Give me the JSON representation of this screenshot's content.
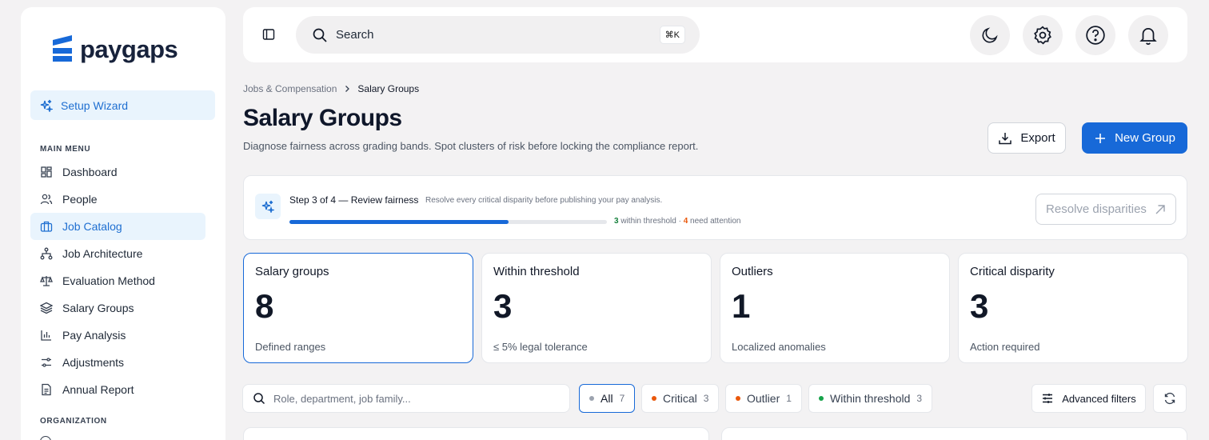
{
  "app": {
    "name": "paygaps"
  },
  "sidebar": {
    "wizard_label": "Setup Wizard",
    "main_menu_label": "MAIN MENU",
    "items": [
      {
        "label": "Dashboard",
        "icon": "dashboard-icon"
      },
      {
        "label": "People",
        "icon": "people-icon"
      },
      {
        "label": "Job Catalog",
        "icon": "briefcase-icon",
        "active": true
      },
      {
        "label": "Job Architecture",
        "icon": "hierarchy-icon"
      },
      {
        "label": "Evaluation Method",
        "icon": "scale-icon"
      },
      {
        "label": "Salary Groups",
        "icon": "layers-icon"
      },
      {
        "label": "Pay Analysis",
        "icon": "bar-chart-icon"
      },
      {
        "label": "Adjustments",
        "icon": "sliders-icon"
      },
      {
        "label": "Annual Report",
        "icon": "document-icon"
      }
    ],
    "organization_label": "ORGANIZATION"
  },
  "topbar": {
    "search_placeholder": "Search",
    "shortcut": "⌘K",
    "icons": [
      "moon-icon",
      "settings-icon",
      "help-icon",
      "bell-icon"
    ]
  },
  "breadcrumb": {
    "parent": "Jobs & Compensation",
    "current": "Salary Groups"
  },
  "page": {
    "title": "Salary Groups",
    "subtitle": "Diagnose fairness across grading bands. Spot clusters of risk before locking the compliance report.",
    "export_label": "Export",
    "new_label": "New Group"
  },
  "progress": {
    "step": "Step 3 of 4 — Review fairness",
    "note": "Resolve every critical disparity before publishing your pay analysis.",
    "completion": 0.69,
    "within_count": "3",
    "within_text": " within threshold · ",
    "attention_count": "4",
    "attention_text": " need attention",
    "resolve_label": "Resolve disparities"
  },
  "stats": [
    {
      "label": "Salary groups",
      "value": "8",
      "caption": "Defined ranges"
    },
    {
      "label": "Within threshold",
      "value": "3",
      "caption": "≤ 5% legal tolerance"
    },
    {
      "label": "Outliers",
      "value": "1",
      "caption": "Localized anomalies"
    },
    {
      "label": "Critical disparity",
      "value": "3",
      "caption": "Action required"
    }
  ],
  "filters": {
    "search_placeholder": "Role, department, job family...",
    "chips": [
      {
        "label": "All",
        "count": "7",
        "color": "#9ca3af"
      },
      {
        "label": "Critical",
        "count": "3",
        "color": "#ea580c"
      },
      {
        "label": "Outlier",
        "count": "1",
        "color": "#ea580c"
      },
      {
        "label": "Within threshold",
        "count": "3",
        "color": "#16a34a"
      }
    ],
    "advanced_label": "Advanced filters"
  },
  "colors": {
    "accent": "#1769d8",
    "critical": "#ea580c",
    "ok": "#16a34a"
  }
}
